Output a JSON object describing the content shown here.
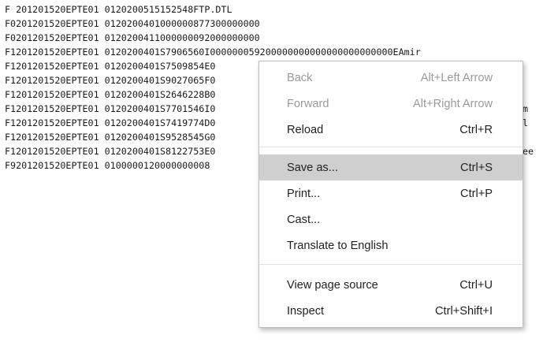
{
  "document": {
    "lines": [
      "F 201201520EPTE01 0120200515152548FTP.DTL",
      "F0201201520EPTE01 0120200401000000877300000000",
      "F0201201520EPTE01 0120200411000000092000000000",
      "F1201201520EPTE01 0120200401S7906560I000000059200000000000000000000000EAmir",
      "F1201201520EPTE01 0120200401S7509854E0",
      "F1201201520EPTE01 0120200401S9027065F0",
      "F1201201520EPTE01 0120200401S2646228B0",
      "F1201201520EPTE01 0120200401S7701546I0",
      "F1201201520EPTE01 0120200401S7419774D0",
      "F1201201520EPTE01 0120200401S9528545G0",
      "F1201201520EPTE01 0120200401S8122753E0",
      "F9201201520EPTE01 0100000120000000008"
    ],
    "tails": [
      "m",
      "l",
      "ee"
    ]
  },
  "context_menu": {
    "items": [
      {
        "label": "Back",
        "shortcut": "Alt+Left Arrow",
        "enabled": false
      },
      {
        "label": "Forward",
        "shortcut": "Alt+Right Arrow",
        "enabled": false
      },
      {
        "label": "Reload",
        "shortcut": "Ctrl+R",
        "enabled": true
      },
      {
        "label": "Save as...",
        "shortcut": "Ctrl+S",
        "enabled": true,
        "highlighted": true
      },
      {
        "label": "Print...",
        "shortcut": "Ctrl+P",
        "enabled": true
      },
      {
        "label": "Cast...",
        "shortcut": "",
        "enabled": true
      },
      {
        "label": "Translate to English",
        "shortcut": "",
        "enabled": true
      },
      {
        "label": "View page source",
        "shortcut": "Ctrl+U",
        "enabled": true
      },
      {
        "label": "Inspect",
        "shortcut": "Ctrl+Shift+I",
        "enabled": true
      }
    ]
  }
}
